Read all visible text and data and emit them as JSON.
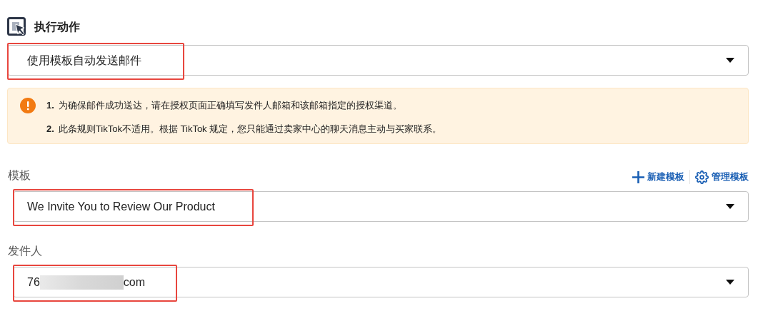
{
  "section": {
    "title": "执行动作"
  },
  "action_select": {
    "value": "使用模板自动发送邮件",
    "highlighted": true
  },
  "notice": {
    "items": [
      {
        "number": "1.",
        "text": "为确保邮件成功送达，请在授权页面正确填写发件人邮箱和该邮箱指定的授权渠道。"
      },
      {
        "number": "2.",
        "text": "此条规则TikTok不适用。根据 TikTok 规定，您只能通过卖家中心的聊天消息主动与买家联系。"
      }
    ]
  },
  "template": {
    "label": "模板",
    "links": [
      {
        "kind": "add",
        "text": "新建模板"
      },
      {
        "kind": "manage",
        "text": "管理模板"
      }
    ],
    "value": "We Invite You to Review Our Product",
    "highlighted": true
  },
  "sender": {
    "label": "发件人",
    "value_start": "76",
    "value_end": "com",
    "redacted": true,
    "highlighted": true
  }
}
